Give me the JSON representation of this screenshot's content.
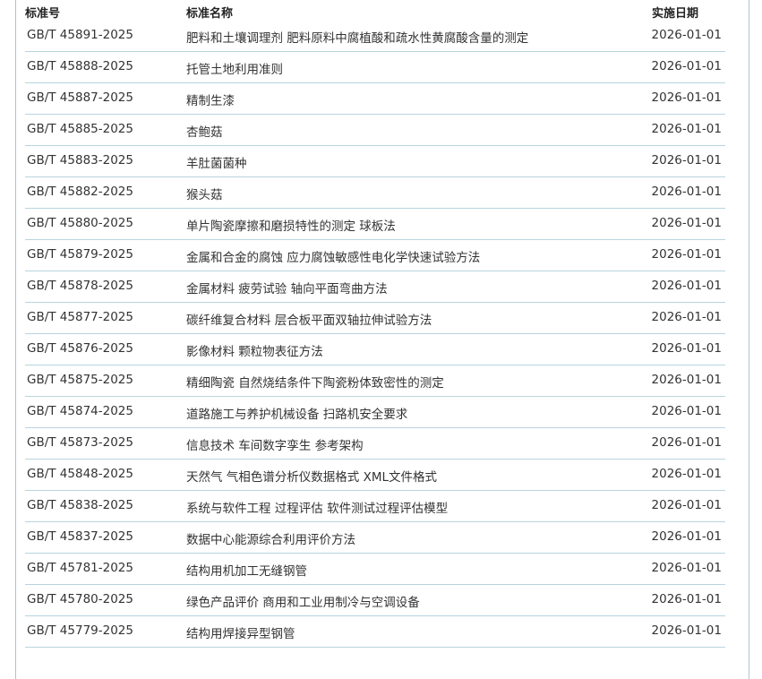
{
  "header": {
    "code": "标准号",
    "name": "标准名称",
    "date": "实施日期"
  },
  "rows": [
    {
      "code": "GB/T 45891-2025",
      "name": "肥料和土壤调理剂 肥料原料中腐植酸和疏水性黄腐酸含量的测定",
      "date": "2026-01-01"
    },
    {
      "code": "GB/T 45888-2025",
      "name": "托管土地利用准则",
      "date": "2026-01-01"
    },
    {
      "code": "GB/T 45887-2025",
      "name": "精制生漆",
      "date": "2026-01-01"
    },
    {
      "code": "GB/T 45885-2025",
      "name": "杏鲍菇",
      "date": "2026-01-01"
    },
    {
      "code": "GB/T 45883-2025",
      "name": "羊肚菌菌种",
      "date": "2026-01-01"
    },
    {
      "code": "GB/T 45882-2025",
      "name": "猴头菇",
      "date": "2026-01-01"
    },
    {
      "code": "GB/T 45880-2025",
      "name": "单片陶瓷摩擦和磨损特性的测定 球板法",
      "date": "2026-01-01"
    },
    {
      "code": "GB/T 45879-2025",
      "name": "金属和合金的腐蚀 应力腐蚀敏感性电化学快速试验方法",
      "date": "2026-01-01"
    },
    {
      "code": "GB/T 45878-2025",
      "name": "金属材料 疲劳试验 轴向平面弯曲方法",
      "date": "2026-01-01"
    },
    {
      "code": "GB/T 45877-2025",
      "name": "碳纤维复合材料 层合板平面双轴拉伸试验方法",
      "date": "2026-01-01"
    },
    {
      "code": "GB/T 45876-2025",
      "name": "影像材料 颗粒物表征方法",
      "date": "2026-01-01"
    },
    {
      "code": "GB/T 45875-2025",
      "name": "精细陶瓷 自然烧结条件下陶瓷粉体致密性的测定",
      "date": "2026-01-01"
    },
    {
      "code": "GB/T 45874-2025",
      "name": "道路施工与养护机械设备 扫路机安全要求",
      "date": "2026-01-01"
    },
    {
      "code": "GB/T 45873-2025",
      "name": "信息技术 车间数字孪生 参考架构",
      "date": "2026-01-01"
    },
    {
      "code": "GB/T 45848-2025",
      "name": "天然气 气相色谱分析仪数据格式 XML文件格式",
      "date": "2026-01-01"
    },
    {
      "code": "GB/T 45838-2025",
      "name": "系统与软件工程 过程评估 软件测试过程评估模型",
      "date": "2026-01-01"
    },
    {
      "code": "GB/T 45837-2025",
      "name": "数据中心能源综合利用评价方法",
      "date": "2026-01-01"
    },
    {
      "code": "GB/T 45781-2025",
      "name": "结构用机加工无缝钢管",
      "date": "2026-01-01"
    },
    {
      "code": "GB/T 45780-2025",
      "name": "绿色产品评价 商用和工业用制冷与空调设备",
      "date": "2026-01-01"
    },
    {
      "code": "GB/T 45779-2025",
      "name": "结构用焊接异型钢管",
      "date": "2026-01-01"
    }
  ]
}
